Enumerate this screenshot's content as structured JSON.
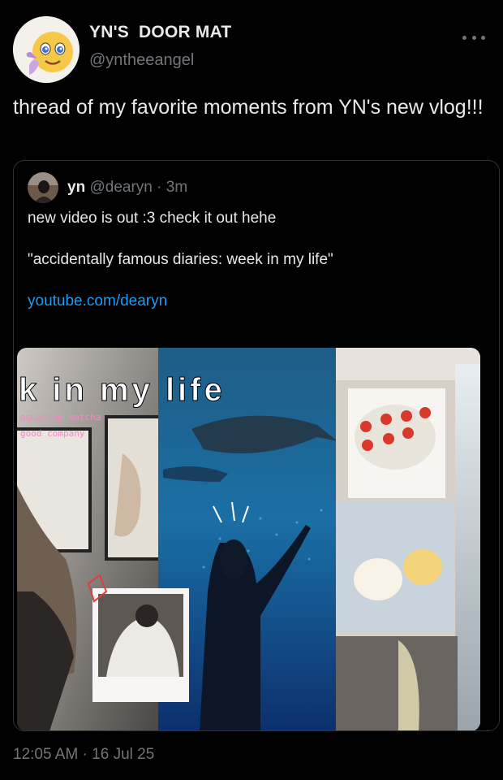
{
  "tweet": {
    "display_name": "YN'S  DOOR MAT",
    "handle": "@yntheeangel",
    "text": "thread of my favorite moments from YN's new vlog!!!",
    "timestamp": "12:05 AM · 16 Jul 25",
    "more_icon": "more-horizontal-icon"
  },
  "quoted": {
    "name": "yn",
    "handle": "@dearyn",
    "time": "3m",
    "line1": "new video is out :3 check it out hehe",
    "line2": "\"accidentally famous diaries: week in my life\"",
    "link": "youtube.com/dearyn",
    "thumbnail": {
      "title": "k in my life",
      "tag1": "aquarium  matcha",
      "tag2": "good  company"
    }
  },
  "colors": {
    "background": "#000000",
    "text": "#e7e9ea",
    "muted": "#71767b",
    "link": "#1d9bf0",
    "border": "#2f3336"
  }
}
